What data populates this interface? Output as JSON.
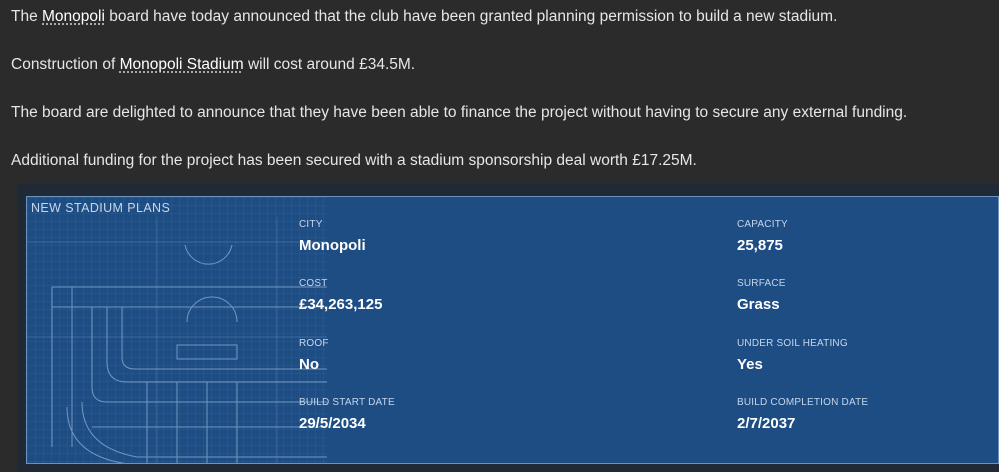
{
  "news": {
    "p1": {
      "pre": "The ",
      "link": "Monopoli",
      "post": " board have today announced that the club have been granted planning permission to build a new stadium."
    },
    "p2": {
      "pre": "Construction of ",
      "link": "Monopoli Stadium",
      "post": " will cost around £34.5M."
    },
    "p3": {
      "text": "The board are delighted to announce that they have been able to finance the project without having to secure any external funding."
    },
    "p4": {
      "text": "Additional funding for the project has been secured with a stadium sponsorship deal worth £17.25M."
    }
  },
  "panel": {
    "title": "NEW STADIUM PLANS",
    "fields": {
      "city": {
        "label": "CITY",
        "value": "Monopoli"
      },
      "capacity": {
        "label": "CAPACITY",
        "value": "25,875"
      },
      "cost": {
        "label": "COST",
        "value": "£34,263,125"
      },
      "surface": {
        "label": "SURFACE",
        "value": "Grass"
      },
      "roof": {
        "label": "ROOF",
        "value": "No"
      },
      "heating": {
        "label": "UNDER SOIL HEATING",
        "value": "Yes"
      },
      "start": {
        "label": "BUILD START DATE",
        "value": "29/5/2034"
      },
      "completion": {
        "label": "BUILD COMPLETION DATE",
        "value": "2/7/2037"
      }
    }
  },
  "colors": {
    "background": "#2b2b2b",
    "panel": "#1e4d84",
    "panel_border": "#6d93bd"
  }
}
